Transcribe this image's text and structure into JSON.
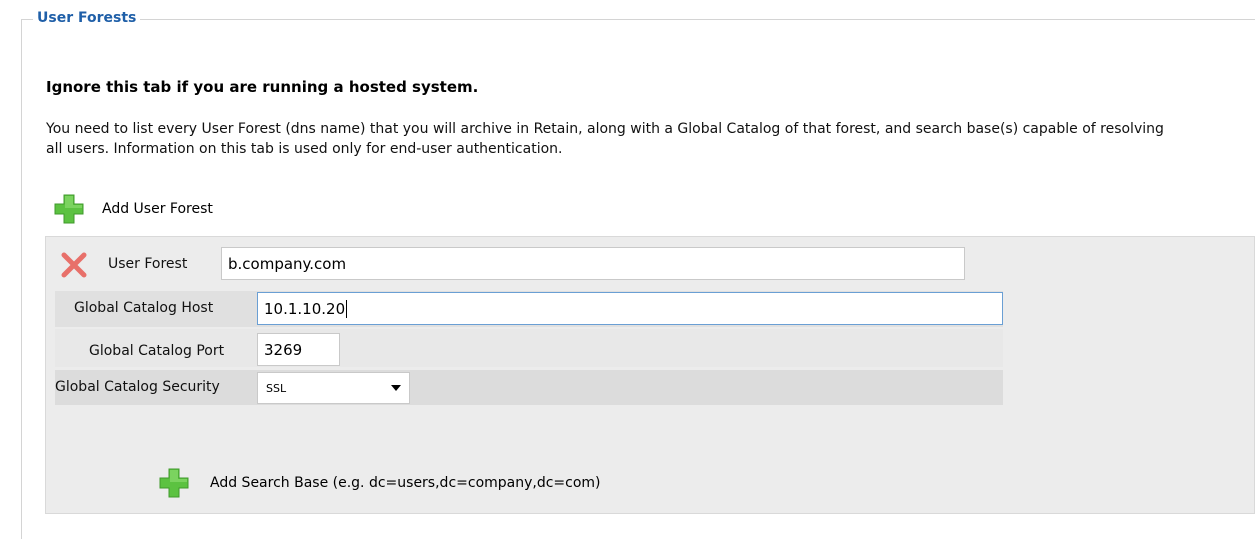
{
  "section": {
    "legend": "User Forests",
    "notice": "Ignore this tab if you are running a hosted system.",
    "description": "You need to list every User Forest (dns name) that you will archive in Retain, along with a Global Catalog of that forest, and search base(s) capable of resolving all users. Information on this tab is used only for end-user authentication."
  },
  "add_forest": {
    "label": "Add User Forest",
    "icon": "plus-icon"
  },
  "forest": {
    "remove_icon": "remove-x-icon",
    "forest_label": "User Forest",
    "forest_value": "b.company.com",
    "gc_host_label": "Global Catalog Host",
    "gc_host_value": "10.1.10.20",
    "gc_port_label": "Global Catalog Port",
    "gc_port_value": "3269",
    "gc_security_label": "Global Catalog Security",
    "gc_security_value": "SSL"
  },
  "add_search_base": {
    "label": "Add Search Base (e.g. dc=users,dc=company,dc=com)",
    "icon": "plus-icon"
  },
  "colors": {
    "legend": "#1f5fa8",
    "plus": "#5cc241",
    "remove": "#e8706a"
  }
}
